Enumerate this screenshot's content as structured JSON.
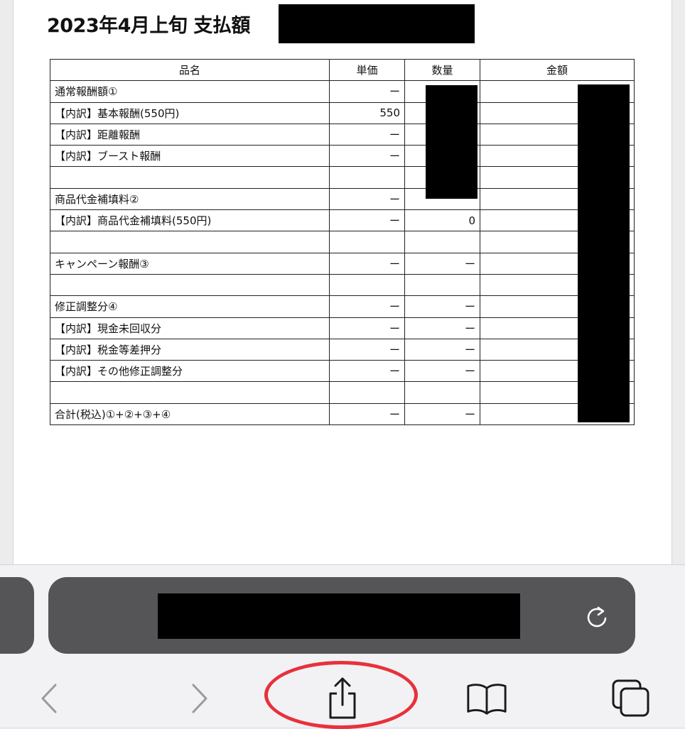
{
  "document": {
    "title": "2023年4月上旬 支払額",
    "table": {
      "headers": [
        "品名",
        "単価",
        "数量",
        "金額"
      ],
      "rows": [
        {
          "name": "通常報酬額①",
          "unit_price": "ー",
          "quantity": "",
          "amount": ""
        },
        {
          "name": "【内訳】基本報酬(550円)",
          "unit_price": "550",
          "quantity": "",
          "amount": ""
        },
        {
          "name": "【内訳】距離報酬",
          "unit_price": "ー",
          "quantity": "",
          "amount": ""
        },
        {
          "name": "【内訳】ブースト報酬",
          "unit_price": "ー",
          "quantity": "",
          "amount": ""
        },
        {
          "name": "",
          "unit_price": "",
          "quantity": "",
          "amount": ""
        },
        {
          "name": "商品代金補填料②",
          "unit_price": "ー",
          "quantity": "",
          "amount": ""
        },
        {
          "name": "【内訳】商品代金補填料(550円)",
          "unit_price": "ー",
          "quantity": "0",
          "amount": ""
        },
        {
          "name": "",
          "unit_price": "",
          "quantity": "",
          "amount": ""
        },
        {
          "name": "キャンペーン報酬③",
          "unit_price": "ー",
          "quantity": "ー",
          "amount": ""
        },
        {
          "name": "",
          "unit_price": "",
          "quantity": "",
          "amount": ""
        },
        {
          "name": "修正調整分④",
          "unit_price": "ー",
          "quantity": "ー",
          "amount": ""
        },
        {
          "name": "【内訳】現金未回収分",
          "unit_price": "ー",
          "quantity": "ー",
          "amount": ""
        },
        {
          "name": "【内訳】税金等差押分",
          "unit_price": "ー",
          "quantity": "ー",
          "amount": ""
        },
        {
          "name": "【内訳】その他修正調整分",
          "unit_price": "ー",
          "quantity": "ー",
          "amount": ""
        },
        {
          "name": "",
          "unit_price": "",
          "quantity": "",
          "amount": ""
        },
        {
          "name": "合計(税込)①+②+③+④",
          "unit_price": "ー",
          "quantity": "ー",
          "amount": ""
        }
      ]
    }
  },
  "browser": {
    "icons": {
      "reload": "reload-icon",
      "back": "chevron-left-icon",
      "forward": "chevron-right-icon",
      "share": "share-icon",
      "bookmarks": "book-icon",
      "tabs": "tabs-icon"
    },
    "annotation_color": "#e8313b"
  }
}
